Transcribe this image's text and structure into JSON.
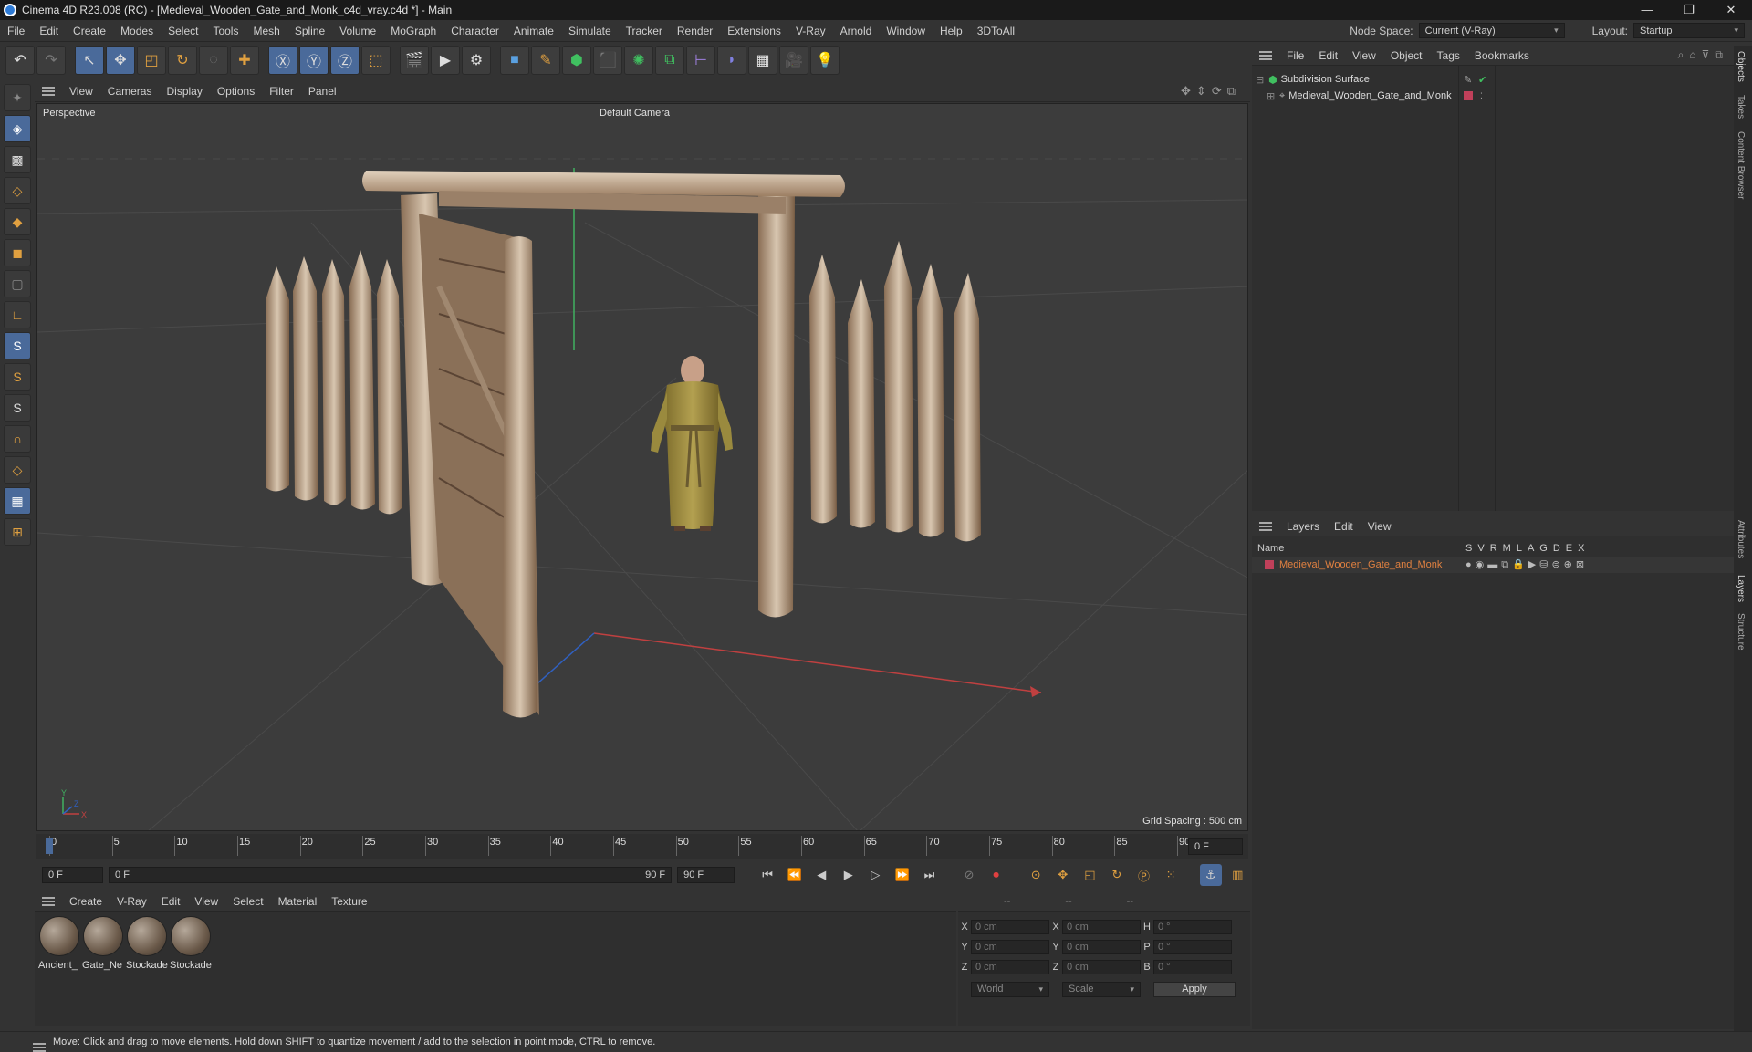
{
  "title": "Cinema 4D R23.008 (RC) - [Medieval_Wooden_Gate_and_Monk_c4d_vray.c4d *] - Main",
  "window_buttons": [
    "—",
    "❐",
    "✕"
  ],
  "menu": [
    "File",
    "Edit",
    "Create",
    "Modes",
    "Select",
    "Tools",
    "Mesh",
    "Spline",
    "Volume",
    "MoGraph",
    "Character",
    "Animate",
    "Simulate",
    "Tracker",
    "Render",
    "Extensions",
    "V-Ray",
    "Arnold",
    "Window",
    "Help",
    "3DToAll"
  ],
  "node_space": {
    "label": "Node Space:",
    "value": "Current (V-Ray)"
  },
  "layout": {
    "label": "Layout:",
    "value": "Startup"
  },
  "viewport": {
    "menu": [
      "View",
      "Cameras",
      "Display",
      "Options",
      "Filter",
      "Panel"
    ],
    "label": "Perspective",
    "camera": "Default Camera",
    "grid_spacing": "Grid Spacing : 500 cm"
  },
  "timeline": {
    "ticks": [
      "0",
      "5",
      "10",
      "15",
      "20",
      "25",
      "30",
      "35",
      "40",
      "45",
      "50",
      "55",
      "60",
      "65",
      "70",
      "75",
      "80",
      "85",
      "90"
    ],
    "current_frame": "0 F",
    "start": "0 F",
    "range_start": "0 F",
    "range_end": "90 F",
    "end": "90 F"
  },
  "material_menu": [
    "Create",
    "V-Ray",
    "Edit",
    "View",
    "Select",
    "Material",
    "Texture"
  ],
  "materials": [
    "Ancient_",
    "Gate_Ne",
    "Stockade",
    "Stockade"
  ],
  "coords": {
    "header": [
      "--",
      "--",
      "--"
    ],
    "rows": [
      {
        "a": "X",
        "v1": "0 cm",
        "b": "X",
        "v2": "0 cm",
        "c": "H",
        "v3": "0 °"
      },
      {
        "a": "Y",
        "v1": "0 cm",
        "b": "Y",
        "v2": "0 cm",
        "c": "P",
        "v3": "0 °"
      },
      {
        "a": "Z",
        "v1": "0 cm",
        "b": "Z",
        "v2": "0 cm",
        "c": "B",
        "v3": "0 °"
      }
    ],
    "world": "World",
    "scale": "Scale",
    "apply": "Apply"
  },
  "objects_menu": [
    "File",
    "Edit",
    "View",
    "Object",
    "Tags",
    "Bookmarks"
  ],
  "objects": [
    {
      "name": "Subdivision Surface"
    },
    {
      "name": "Medieval_Wooden_Gate_and_Monk"
    }
  ],
  "layers_menu": [
    "Layers",
    "Edit",
    "View"
  ],
  "layers_header": {
    "name": "Name",
    "cols": [
      "S",
      "V",
      "R",
      "M",
      "L",
      "A",
      "G",
      "D",
      "E",
      "X"
    ]
  },
  "layers": [
    {
      "name": "Medieval_Wooden_Gate_and_Monk",
      "color": "#c0405a"
    }
  ],
  "side_tabs": [
    "Objects",
    "Takes",
    "Content Browser",
    "Attributes",
    "Layers",
    "Structure"
  ],
  "status": "Move: Click and drag to move elements. Hold down SHIFT to quantize movement / add to the selection in point mode, CTRL to remove.",
  "colors": {
    "accent": "#4a6a9a",
    "layer": "#c0405a",
    "x_axis": "#c04040",
    "y_axis": "#40b060"
  }
}
